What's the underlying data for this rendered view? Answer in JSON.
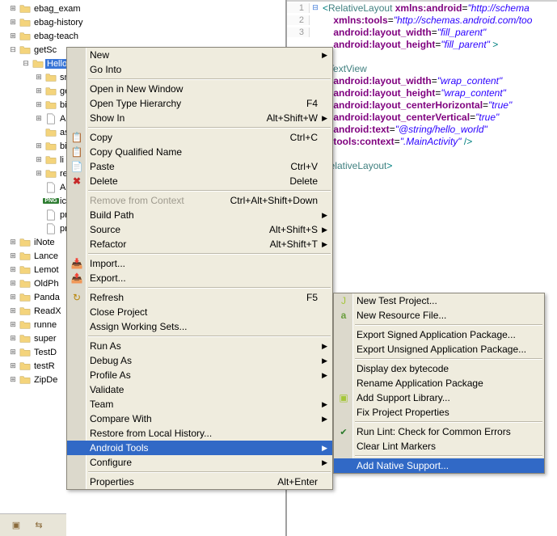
{
  "tree": {
    "items": [
      {
        "label": "ebag_exam",
        "icon": "folder",
        "expand": "plus",
        "indent": 0
      },
      {
        "label": "ebag-history",
        "icon": "folder",
        "expand": "plus",
        "indent": 0
      },
      {
        "label": "ebag-teach",
        "icon": "folder",
        "expand": "plus",
        "indent": 0
      },
      {
        "label": "getSc",
        "icon": "folder",
        "expand": "minus",
        "indent": 0
      },
      {
        "label": "Hello",
        "icon": "folder",
        "expand": "minus",
        "indent": 1,
        "selected": true
      },
      {
        "label": "sr",
        "icon": "folder",
        "expand": "plus",
        "indent": 2
      },
      {
        "label": "ge",
        "icon": "folder",
        "expand": "plus",
        "indent": 2
      },
      {
        "label": "bi",
        "icon": "folder",
        "expand": "plus",
        "indent": 2
      },
      {
        "label": "An",
        "icon": "file",
        "expand": "plus",
        "indent": 2
      },
      {
        "label": "as",
        "icon": "folder",
        "expand": "none",
        "indent": 2
      },
      {
        "label": "bi",
        "icon": "folder",
        "expand": "plus",
        "indent": 2
      },
      {
        "label": "li",
        "icon": "folder",
        "expand": "plus",
        "indent": 2
      },
      {
        "label": "re",
        "icon": "folder",
        "expand": "plus",
        "indent": 2
      },
      {
        "label": "An",
        "icon": "file",
        "expand": "none",
        "indent": 2
      },
      {
        "label": "ic",
        "icon": "png",
        "expand": "none",
        "indent": 2
      },
      {
        "label": "pr",
        "icon": "file",
        "expand": "none",
        "indent": 2
      },
      {
        "label": "pr",
        "icon": "file",
        "expand": "none",
        "indent": 2
      },
      {
        "label": "iNote",
        "icon": "folder",
        "expand": "plus",
        "indent": 0
      },
      {
        "label": "Lance",
        "icon": "folder",
        "expand": "plus",
        "indent": 0
      },
      {
        "label": "Lemot",
        "icon": "folder",
        "expand": "plus",
        "indent": 0
      },
      {
        "label": "OldPh",
        "icon": "folder",
        "expand": "plus",
        "indent": 0
      },
      {
        "label": "Panda",
        "icon": "folder",
        "expand": "plus",
        "indent": 0
      },
      {
        "label": "ReadX",
        "icon": "folder",
        "expand": "plus",
        "indent": 0
      },
      {
        "label": "runne",
        "icon": "folder",
        "expand": "plus",
        "indent": 0
      },
      {
        "label": "super",
        "icon": "folder",
        "expand": "plus",
        "indent": 0
      },
      {
        "label": "TestD",
        "icon": "folder",
        "expand": "plus",
        "indent": 0
      },
      {
        "label": "testR",
        "icon": "folder",
        "expand": "plus",
        "indent": 0
      },
      {
        "label": "ZipDe",
        "icon": "folder",
        "expand": "plus",
        "indent": 0
      }
    ]
  },
  "context_menu": {
    "items": [
      {
        "label": "New",
        "arrow": true
      },
      {
        "label": "Go Into"
      },
      {
        "sep": true
      },
      {
        "label": "Open in New Window"
      },
      {
        "label": "Open Type Hierarchy",
        "shortcut": "F4"
      },
      {
        "label": "Show In",
        "shortcut": "Alt+Shift+W",
        "arrow": true
      },
      {
        "sep": true
      },
      {
        "label": "Copy",
        "shortcut": "Ctrl+C",
        "icon": "copy"
      },
      {
        "label": "Copy Qualified Name",
        "icon": "copy"
      },
      {
        "label": "Paste",
        "shortcut": "Ctrl+V",
        "icon": "paste"
      },
      {
        "label": "Delete",
        "shortcut": "Delete",
        "icon": "delete"
      },
      {
        "sep": true
      },
      {
        "label": "Remove from Context",
        "shortcut": "Ctrl+Alt+Shift+Down",
        "disabled": true
      },
      {
        "label": "Build Path",
        "arrow": true
      },
      {
        "label": "Source",
        "shortcut": "Alt+Shift+S",
        "arrow": true
      },
      {
        "label": "Refactor",
        "shortcut": "Alt+Shift+T",
        "arrow": true
      },
      {
        "sep": true
      },
      {
        "label": "Import...",
        "icon": "import"
      },
      {
        "label": "Export...",
        "icon": "export"
      },
      {
        "sep": true
      },
      {
        "label": "Refresh",
        "shortcut": "F5",
        "icon": "refresh"
      },
      {
        "label": "Close Project"
      },
      {
        "label": "Assign Working Sets..."
      },
      {
        "sep": true
      },
      {
        "label": "Run As",
        "arrow": true
      },
      {
        "label": "Debug As",
        "arrow": true
      },
      {
        "label": "Profile As",
        "arrow": true
      },
      {
        "label": "Validate"
      },
      {
        "label": "Team",
        "arrow": true
      },
      {
        "label": "Compare With",
        "arrow": true
      },
      {
        "label": "Restore from Local History..."
      },
      {
        "label": "Android Tools",
        "arrow": true,
        "selected": true
      },
      {
        "label": "Configure",
        "arrow": true
      },
      {
        "sep": true
      },
      {
        "label": "Properties",
        "shortcut": "Alt+Enter"
      }
    ]
  },
  "submenu": {
    "items": [
      {
        "label": "New Test Project...",
        "icon": "android-test"
      },
      {
        "label": "New Resource File...",
        "icon": "android-res"
      },
      {
        "sep": true
      },
      {
        "label": "Export Signed Application Package..."
      },
      {
        "label": "Export Unsigned Application Package..."
      },
      {
        "sep": true
      },
      {
        "label": "Display dex bytecode"
      },
      {
        "label": "Rename Application Package"
      },
      {
        "label": "Add Support Library...",
        "icon": "android"
      },
      {
        "label": "Fix Project Properties"
      },
      {
        "sep": true
      },
      {
        "label": "Run Lint: Check for Common Errors",
        "icon": "check"
      },
      {
        "label": "Clear Lint Markers"
      },
      {
        "sep": true
      },
      {
        "label": "Add Native Support...",
        "selected": true
      }
    ]
  },
  "editor": {
    "lines": [
      {
        "n": "1",
        "mark": "⊟",
        "tokens": [
          {
            "t": "<",
            "c": "punc"
          },
          {
            "t": "RelativeLayout",
            "c": "tag"
          },
          {
            "t": " ",
            "c": ""
          },
          {
            "t": "xmlns:android",
            "c": "attr"
          },
          {
            "t": "=",
            "c": ""
          },
          {
            "t": "\"http://schema",
            "c": "val"
          }
        ]
      },
      {
        "n": "2",
        "tokens": [
          {
            "t": "    ",
            "c": ""
          },
          {
            "t": "xmlns:tools",
            "c": "attr"
          },
          {
            "t": "=",
            "c": ""
          },
          {
            "t": "\"http://schemas.android.com/too",
            "c": "val"
          }
        ]
      },
      {
        "n": "3",
        "tokens": [
          {
            "t": "    ",
            "c": ""
          },
          {
            "t": "android:layout_width",
            "c": "attr"
          },
          {
            "t": "=",
            "c": ""
          },
          {
            "t": "\"fill_parent\"",
            "c": "val"
          }
        ]
      },
      {
        "n": "",
        "tokens": [
          {
            "t": "    ",
            "c": ""
          },
          {
            "t": "android:layout_height",
            "c": "attr"
          },
          {
            "t": "=",
            "c": ""
          },
          {
            "t": "\"fill_parent\"",
            "c": "val"
          },
          {
            "t": " >",
            "c": "punc"
          }
        ]
      },
      {
        "n": "",
        "tokens": [
          {
            "t": "",
            "c": ""
          }
        ]
      },
      {
        "n": "",
        "tokens": [
          {
            "t": "<",
            "c": "punc"
          },
          {
            "t": "TextView",
            "c": "tag"
          }
        ]
      },
      {
        "n": "",
        "tokens": [
          {
            "t": "    ",
            "c": ""
          },
          {
            "t": "android:layout_width",
            "c": "attr"
          },
          {
            "t": "=",
            "c": ""
          },
          {
            "t": "\"wrap_content\"",
            "c": "val"
          }
        ]
      },
      {
        "n": "",
        "tokens": [
          {
            "t": "    ",
            "c": ""
          },
          {
            "t": "android:layout_height",
            "c": "attr"
          },
          {
            "t": "=",
            "c": ""
          },
          {
            "t": "\"wrap_content\"",
            "c": "val"
          }
        ]
      },
      {
        "n": "",
        "tokens": [
          {
            "t": "    ",
            "c": ""
          },
          {
            "t": "android:layout_centerHorizontal",
            "c": "attr"
          },
          {
            "t": "=",
            "c": ""
          },
          {
            "t": "\"true\"",
            "c": "val"
          }
        ]
      },
      {
        "n": "",
        "tokens": [
          {
            "t": "    ",
            "c": ""
          },
          {
            "t": "android:layout_centerVertical",
            "c": "attr"
          },
          {
            "t": "=",
            "c": ""
          },
          {
            "t": "\"true\"",
            "c": "val"
          }
        ]
      },
      {
        "n": "",
        "tokens": [
          {
            "t": "    ",
            "c": ""
          },
          {
            "t": "android:text",
            "c": "attr"
          },
          {
            "t": "=",
            "c": ""
          },
          {
            "t": "\"@string/hello_world\"",
            "c": "val"
          }
        ]
      },
      {
        "n": "",
        "tokens": [
          {
            "t": "    ",
            "c": ""
          },
          {
            "t": "tools:context",
            "c": "attr"
          },
          {
            "t": "=",
            "c": ""
          },
          {
            "t": "\".MainActivity\"",
            "c": "val"
          },
          {
            "t": " />",
            "c": "punc"
          }
        ]
      },
      {
        "n": "",
        "tokens": [
          {
            "t": "",
            "c": ""
          }
        ]
      },
      {
        "n": "",
        "tokens": [
          {
            "t": "RelativeLayout",
            "c": "tag"
          },
          {
            "t": ">",
            "c": "punc"
          }
        ]
      }
    ]
  }
}
